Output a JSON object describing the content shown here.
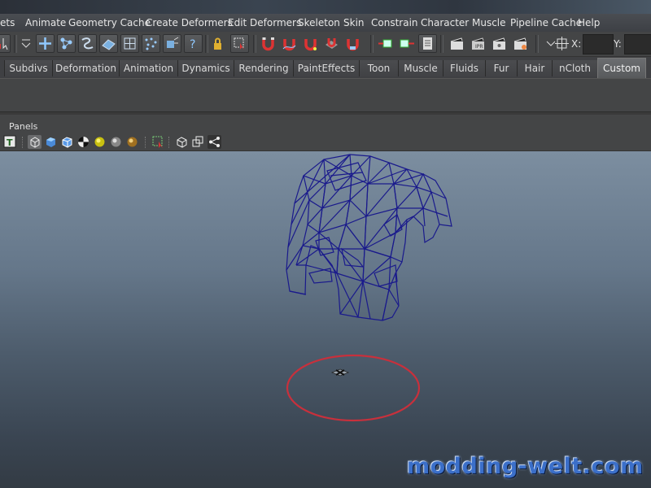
{
  "menubar": {
    "items": [
      "ets",
      "Animate",
      "Geometry Cache",
      "Create Deformers",
      "Edit Deformers",
      "Skeleton",
      "Skin",
      "Constrain",
      "Character",
      "Muscle",
      "Pipeline Cache",
      "Help"
    ]
  },
  "statusline": {
    "x_label": "X:",
    "y_label": "Y:",
    "x_value": "",
    "y_value": ""
  },
  "shelf": {
    "tabs": [
      "Subdivs",
      "Deformation",
      "Animation",
      "Dynamics",
      "Rendering",
      "PaintEffects",
      "Toon",
      "Muscle",
      "Fluids",
      "Fur",
      "Hair",
      "nCloth",
      "Custom"
    ],
    "active_tab": "Custom"
  },
  "panel": {
    "menu_label": "Panels",
    "text_toggle": "T"
  },
  "viewport": {
    "background_top": "#7c8ea0",
    "background_bottom": "#333b44",
    "wireframe_color": "#1a1a8c",
    "highlight_circle_color": "#c8303c"
  },
  "watermark": {
    "text": "modding-welt.com"
  }
}
